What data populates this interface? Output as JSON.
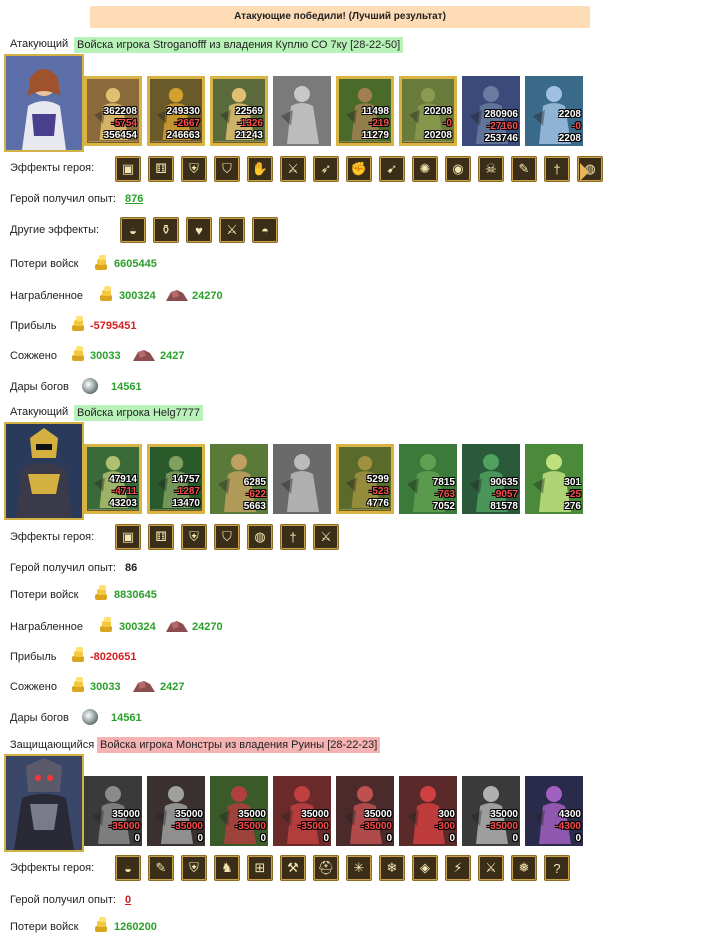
{
  "banner": "Атакующие победили! (Лучший результат)",
  "colors": {
    "green": "#2aa02a",
    "red": "#d42020",
    "banner": "#fddcb6",
    "tag_green": "#b9f2b9",
    "tag_red": "#f6b3b3"
  },
  "sections": [
    {
      "role": "Атакующий",
      "title": "Войска игрока Stroganofff из владения Куплю СО 7ку [28-22-50]",
      "units": [
        {
          "n1": "362208",
          "n2": "-5754",
          "n3": "356454",
          "gold": true
        },
        {
          "n1": "249330",
          "n2": "-2667",
          "n3": "246663",
          "gold": true
        },
        {
          "n1": "22569",
          "n2": "-1326",
          "n3": "21243",
          "gold": true
        },
        {
          "n1": "",
          "n2": "",
          "n3": "",
          "gold": false
        },
        {
          "n1": "11498",
          "n2": "-219",
          "n3": "11279",
          "gold": true
        },
        {
          "n1": "20208",
          "n2": "-0",
          "n3": "20208",
          "gold": true
        },
        {
          "n1": "280906",
          "n2": "-27160",
          "n3": "253746",
          "gold": false
        },
        {
          "n1": "2208",
          "n2": "-0",
          "n3": "2208",
          "gold": false
        }
      ],
      "effects_label": "Эффекты героя:",
      "exp_label": "Герой получил опыт:",
      "exp": "876",
      "other_label": "Другие эффекты:",
      "losses_label": "Потери войск",
      "losses": "6605445",
      "loot_label": "Награбленное",
      "loot_gold": "300324",
      "loot_ore": "24270",
      "profit_label": "Прибыль",
      "profit": "-5795451",
      "burned_label": "Сожжено",
      "burned_gold": "30033",
      "burned_ore": "2427",
      "gifts_label": "Дары богов",
      "gifts": "14561"
    },
    {
      "role": "Атакующий",
      "title": "Войска игрока Helg7777",
      "units": [
        {
          "n1": "47914",
          "n2": "-4711",
          "n3": "43203",
          "gold": true
        },
        {
          "n1": "14757",
          "n2": "-1287",
          "n3": "13470",
          "gold": true
        },
        {
          "n1": "6285",
          "n2": "-622",
          "n3": "5663",
          "gold": false
        },
        {
          "n1": "",
          "n2": "",
          "n3": "",
          "gold": false
        },
        {
          "n1": "5299",
          "n2": "-523",
          "n3": "4776",
          "gold": true
        },
        {
          "n1": "7815",
          "n2": "-763",
          "n3": "7052",
          "gold": false
        },
        {
          "n1": "90635",
          "n2": "-9057",
          "n3": "81578",
          "gold": false
        },
        {
          "n1": "301",
          "n2": "-25",
          "n3": "276",
          "gold": false
        }
      ],
      "effects_label": "Эффекты героя:",
      "exp_label": "Герой получил опыт:",
      "exp": "86",
      "losses_label": "Потери войск",
      "losses": "8830645",
      "loot_label": "Награбленное",
      "loot_gold": "300324",
      "loot_ore": "24270",
      "profit_label": "Прибыль",
      "profit": "-8020651",
      "burned_label": "Сожжено",
      "burned_gold": "30033",
      "burned_ore": "2427",
      "gifts_label": "Дары богов",
      "gifts": "14561"
    },
    {
      "role": "Защищающийся",
      "title": "Войска игрока Монстры из владения Руины [28-22-23]",
      "units": [
        {
          "n1": "35000",
          "n2": "-35000",
          "n3": "0",
          "gold": false
        },
        {
          "n1": "35000",
          "n2": "-35000",
          "n3": "0",
          "gold": false
        },
        {
          "n1": "35000",
          "n2": "-35000",
          "n3": "0",
          "gold": false
        },
        {
          "n1": "35000",
          "n2": "-35000",
          "n3": "0",
          "gold": false
        },
        {
          "n1": "35000",
          "n2": "-35000",
          "n3": "0",
          "gold": false
        },
        {
          "n1": "300",
          "n2": "-300",
          "n3": "0",
          "gold": false
        },
        {
          "n1": "35000",
          "n2": "-35000",
          "n3": "0",
          "gold": false
        },
        {
          "n1": "4300",
          "n2": "-4300",
          "n3": "0",
          "gold": false
        }
      ],
      "effects_label": "Эффекты героя:",
      "exp_label": "Герой получил опыт:",
      "exp": "0",
      "losses_label": "Потери войск",
      "losses": "1260200"
    }
  ]
}
